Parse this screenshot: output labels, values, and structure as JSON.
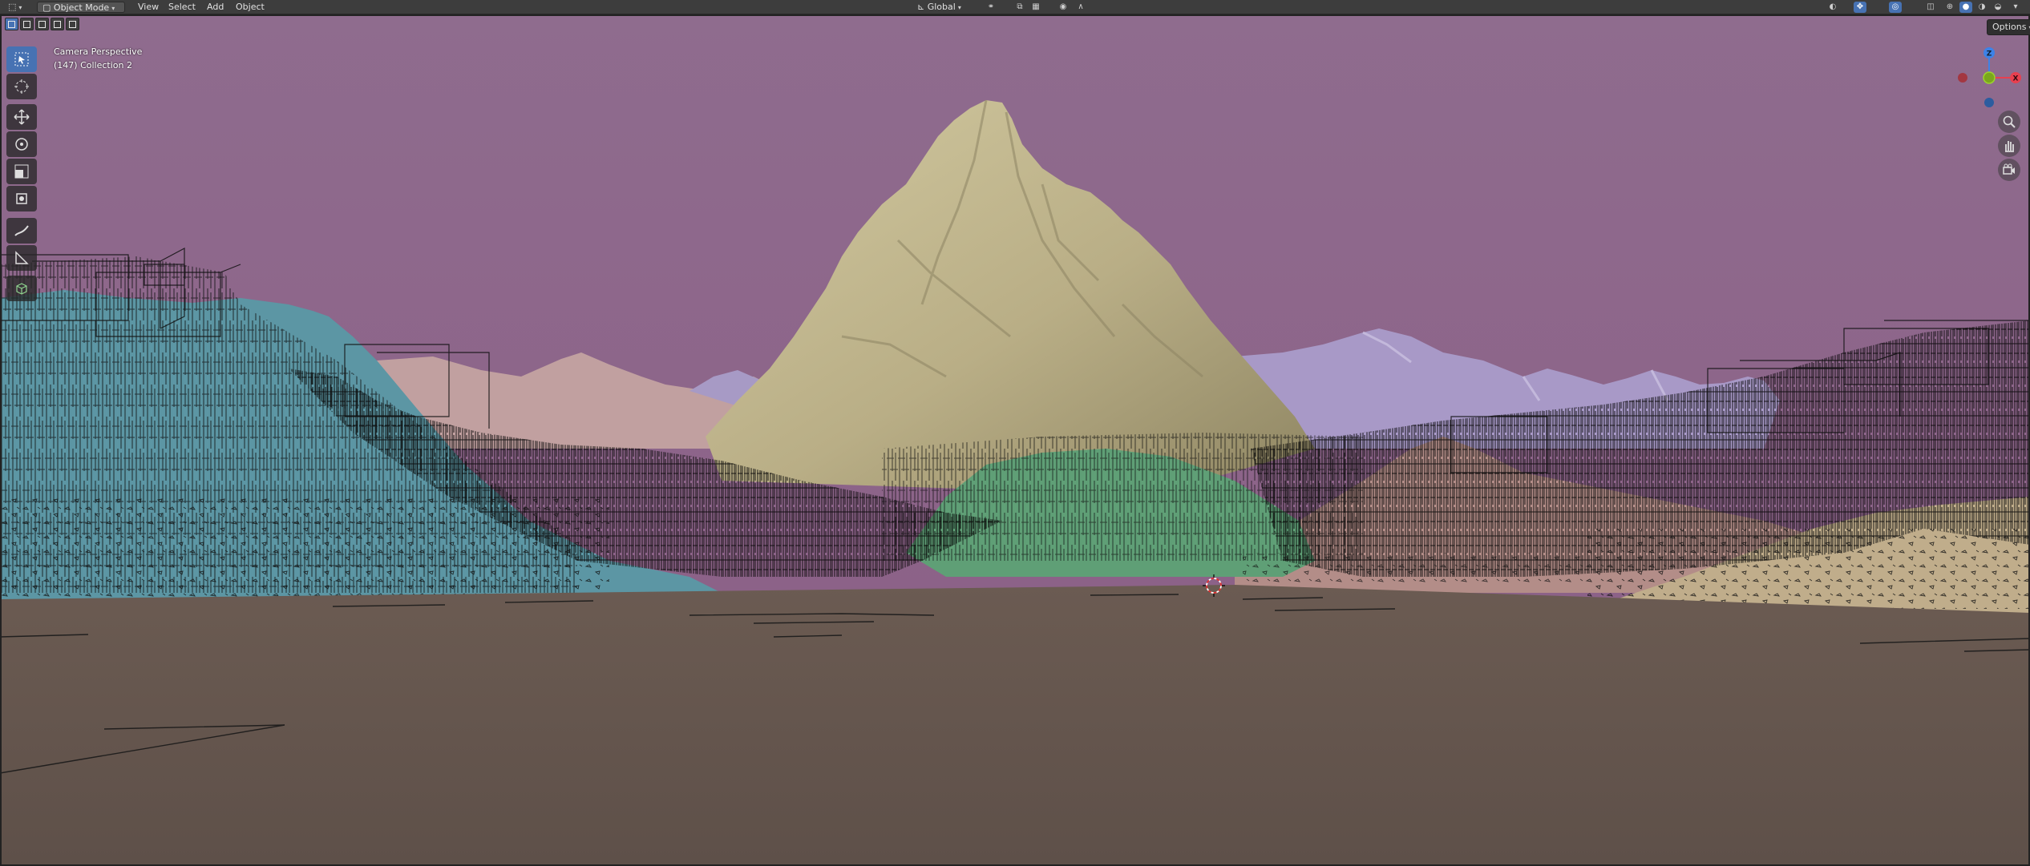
{
  "header": {
    "mode_label": "Object Mode",
    "menus": [
      "View",
      "Select",
      "Add",
      "Object"
    ],
    "transform_orientation": "Global",
    "options_label": "Options"
  },
  "viewport": {
    "view_name": "Camera Perspective",
    "collection_info": "(147) Collection 2"
  },
  "gizmo": {
    "z_label": "Z",
    "x_label": "X",
    "colors": {
      "x": "#e8404f",
      "y": "#8ccd1a",
      "z": "#3d82e6"
    }
  },
  "toolbar": {
    "tools": [
      "select-box",
      "cursor",
      "move",
      "rotate",
      "scale",
      "transform",
      "annotate",
      "measure",
      "add-cube"
    ],
    "active": "select-box"
  },
  "scene_colors": {
    "sky": "#8f6c8e",
    "ground": "#67584f",
    "main_peak": "#c0b68e",
    "left_hill": "#5c96a4",
    "back_left": "#c1a0a0",
    "back_right": "#a899c7",
    "middle_green": "#5f9f76",
    "right_pink": "#b38d88",
    "right_sand": "#c0ad8b"
  }
}
